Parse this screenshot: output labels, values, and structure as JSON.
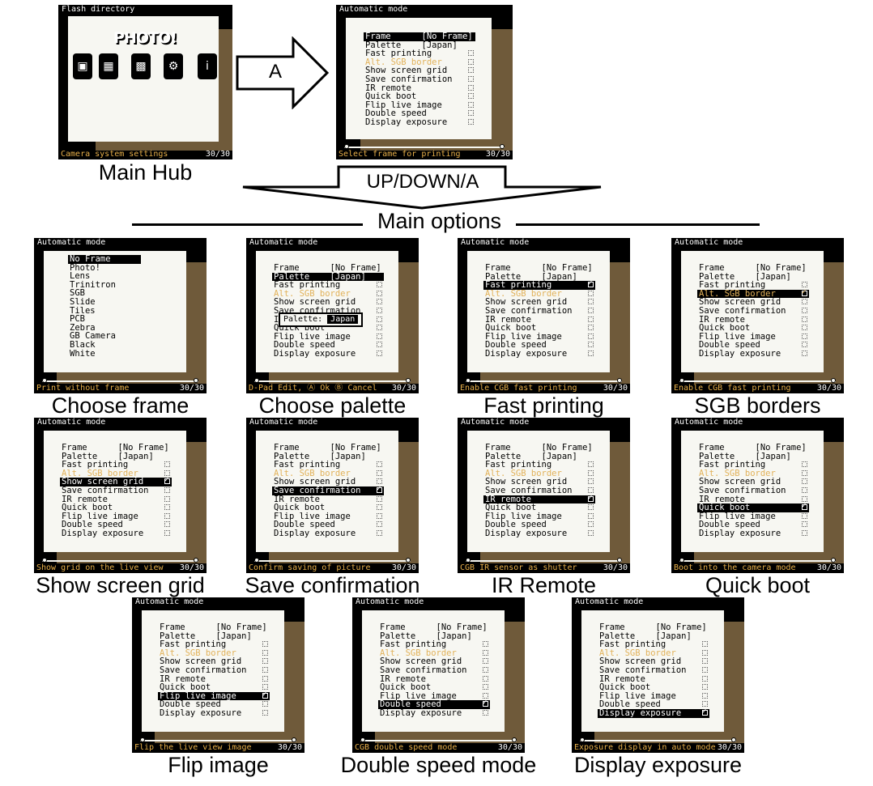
{
  "main_hub": {
    "header": "Flash directory",
    "logo": "PHOTO!",
    "status": "Camera system settings",
    "counter": "30/30",
    "caption": "Main Hub",
    "icons": [
      "camera-body-icon",
      "film-roll-icon",
      "chip-icon",
      "gear-hand-icon",
      "info-icon"
    ]
  },
  "arrow_label": "A",
  "down_arrow_label": "UP/DOWN/A",
  "section_label": "Main options",
  "settings_menu": {
    "header": "Automatic mode",
    "status": "Select frame for printing",
    "counter": "30/30",
    "items": [
      {
        "label": "Frame      [No Frame]",
        "check": false
      },
      {
        "label": "Palette    [Japan]",
        "check": false
      },
      {
        "label": "Fast printing",
        "check": true
      },
      {
        "label": "Alt. SGB border",
        "check": true,
        "disabled": true
      },
      {
        "label": "Show screen grid",
        "check": true
      },
      {
        "label": "Save confirmation",
        "check": true
      },
      {
        "label": "IR remote",
        "check": true
      },
      {
        "label": "Quick boot",
        "check": true
      },
      {
        "label": "Flip live image",
        "check": true
      },
      {
        "label": "Double speed",
        "check": true
      },
      {
        "label": "Display exposure",
        "check": true
      }
    ]
  },
  "frame_list": [
    "No Frame",
    "Photo!",
    "Lens",
    "Trinitron",
    "SGB",
    "Slide",
    "Tiles",
    "PCB",
    "Zebra",
    "GB Camera",
    "Black",
    "White"
  ],
  "palette_popup": {
    "label": "Palette:",
    "value": "Japan"
  },
  "panels": [
    {
      "caption": "Choose frame",
      "status": "Print without frame",
      "counter": "30/30"
    },
    {
      "caption": "Choose palette",
      "status": "D-Pad Edit, Ⓐ Ok Ⓑ Cancel",
      "counter": "30/30"
    },
    {
      "caption": "Fast printing",
      "status": "Enable CGB fast printing",
      "counter": "30/30"
    },
    {
      "caption": "SGB borders",
      "status": "Enable CGB fast printing",
      "counter": "30/30"
    },
    {
      "caption": "Show screen grid",
      "status": "Show grid on the live view",
      "counter": "30/30"
    },
    {
      "caption": "Save confirmation",
      "status": "Confirm saving of picture",
      "counter": "30/30"
    },
    {
      "caption": "IR Remote",
      "status": "CGB IR sensor as shutter",
      "counter": "30/30"
    },
    {
      "caption": "Quick boot",
      "status": "Boot into the camera mode",
      "counter": "30/30"
    },
    {
      "caption": "Flip image",
      "status": "Flip the live view image",
      "counter": "30/30"
    },
    {
      "caption": "Double speed mode",
      "status": "CGB double speed mode",
      "counter": "30/30"
    },
    {
      "caption": "Display exposure",
      "status": "Exposure display in auto mode",
      "counter": "30/30"
    }
  ]
}
